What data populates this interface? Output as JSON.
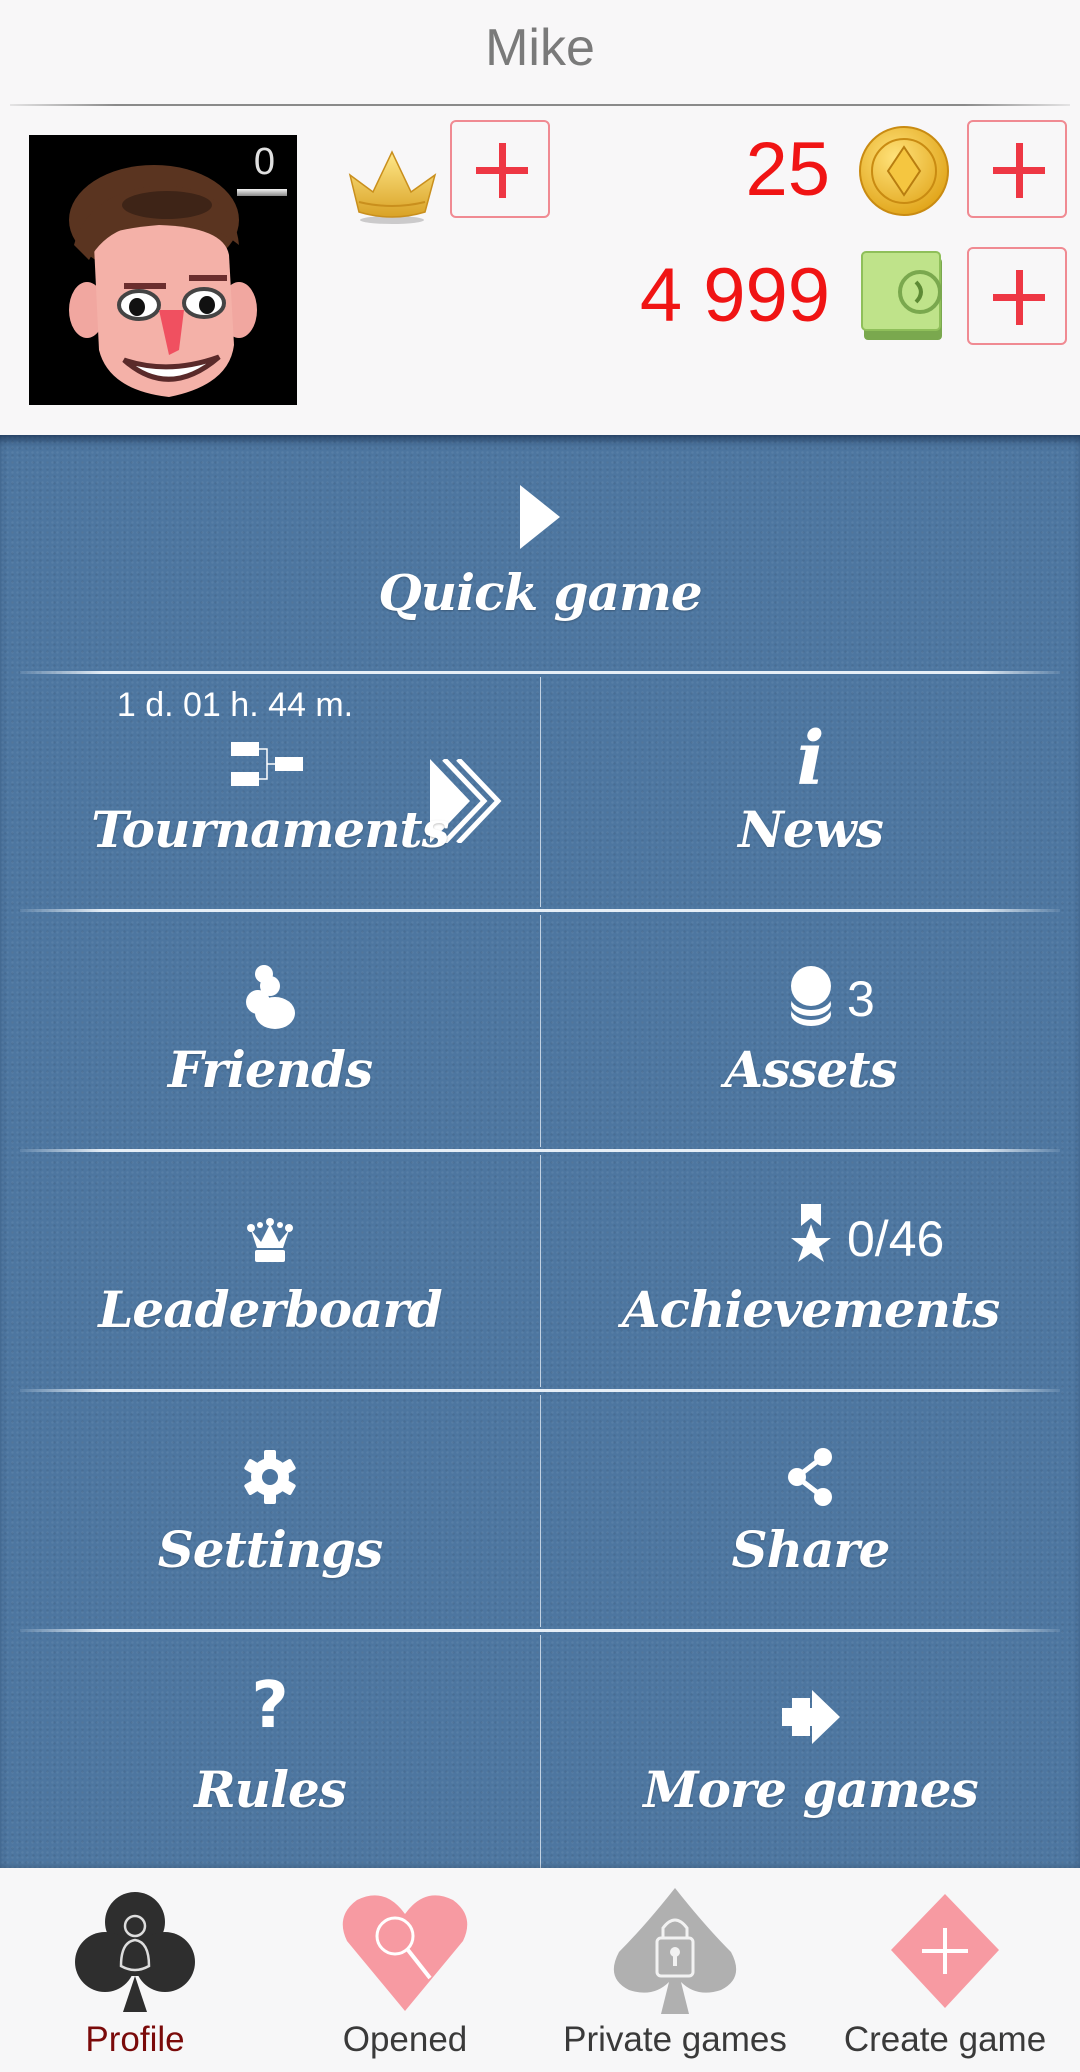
{
  "header": {
    "title": "Mike",
    "level": "0",
    "crown_icon": "crown-icon",
    "coins": "25",
    "cash": "4 999",
    "add_premium_label": "+",
    "add_coins_label": "+",
    "add_cash_label": "+"
  },
  "menu": {
    "quick_game": {
      "label": "Quick game",
      "icon": "play-icon"
    },
    "tournaments": {
      "label": "Tournaments",
      "timer": "1 d. 01 h. 44 m.",
      "icon": "bracket-icon",
      "arrow_icon": "triple-chevron-icon"
    },
    "news": {
      "label": "News",
      "icon": "info-icon"
    },
    "friends": {
      "label": "Friends",
      "icon": "friends-icon"
    },
    "assets": {
      "label": "Assets",
      "count": "3",
      "icon": "coin-stack-icon"
    },
    "leaderboard": {
      "label": "Leaderboard",
      "icon": "queen-crown-icon"
    },
    "achievements": {
      "label": "Achievements",
      "progress": "0/46",
      "icon": "medal-star-icon"
    },
    "settings": {
      "label": "Settings",
      "icon": "gear-icon"
    },
    "share": {
      "label": "Share",
      "icon": "share-icon"
    },
    "rules": {
      "label": "Rules",
      "icon": "question-icon"
    },
    "more_games": {
      "label": "More games",
      "icon": "plus-arrow-icon"
    }
  },
  "nav": {
    "items": [
      {
        "label": "Profile",
        "icon": "club-profile-icon",
        "active": true
      },
      {
        "label": "Opened",
        "icon": "heart-search-icon",
        "active": false
      },
      {
        "label": "Private games",
        "icon": "spade-lock-icon",
        "active": false
      },
      {
        "label": "Create game",
        "icon": "diamond-plus-icon",
        "active": false
      }
    ]
  },
  "colors": {
    "accent_red": "#f01414",
    "panel_blue": "#4d76a0",
    "active_nav": "#7a0a0a",
    "heart_pink": "#f79aa2",
    "spade_gray": "#b0b0b0",
    "club_dark": "#2e2e2e"
  }
}
